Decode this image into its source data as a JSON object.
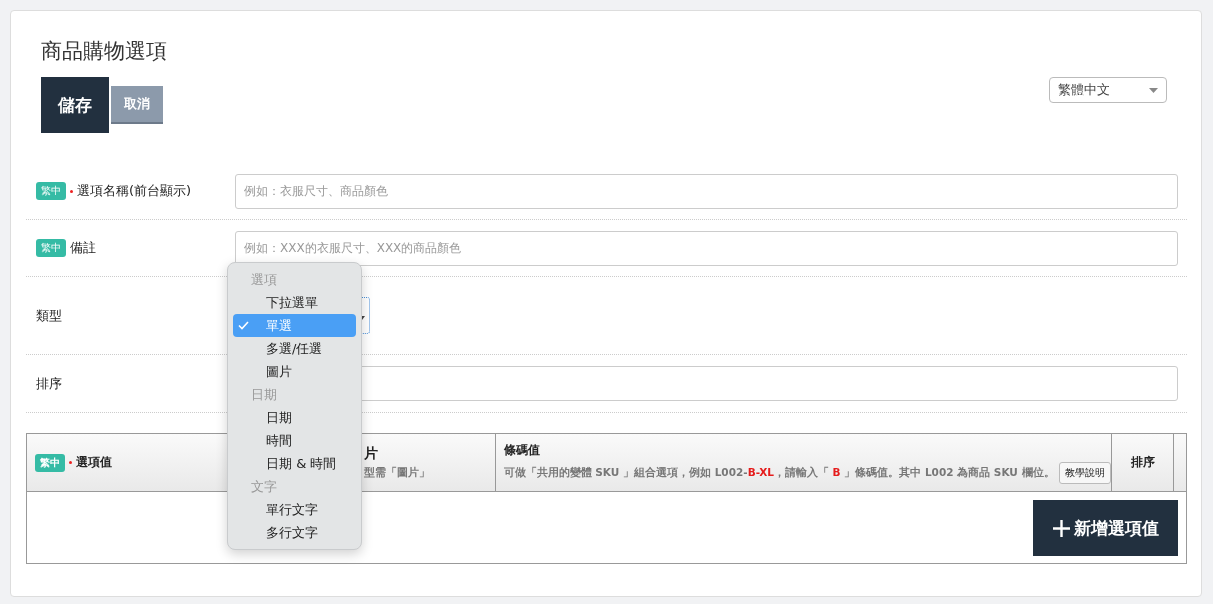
{
  "page_title": "商品購物選項",
  "buttons": [
    {
      "label": "儲存",
      "kind": "primary"
    },
    {
      "label": "取消",
      "kind": "secondary"
    }
  ],
  "language_select": {
    "value": "繁體中文"
  },
  "fields": [
    {
      "kind": "text",
      "lang_tag": "繁中",
      "required": true,
      "label": "選項名稱(前台顯示)",
      "placeholder": "例如：衣服尺寸、商品顏色"
    },
    {
      "kind": "text",
      "lang_tag": "繁中",
      "required": false,
      "label": "備註",
      "placeholder": "例如：XXX的衣服尺寸、XXX的商品顏色"
    },
    {
      "kind": "select",
      "label": "類型"
    },
    {
      "kind": "text",
      "label": "排序"
    }
  ],
  "type_menu": [
    {
      "group": "選項",
      "options": [
        {
          "label": "下拉選單",
          "selected": false
        },
        {
          "label": "單選",
          "selected": true
        },
        {
          "label": "多選/任選",
          "selected": false
        },
        {
          "label": "圖片",
          "selected": false
        }
      ]
    },
    {
      "group": "日期",
      "options": [
        {
          "label": "日期",
          "selected": false
        },
        {
          "label": "時間",
          "selected": false
        },
        {
          "label": "日期 & 時間",
          "selected": false
        }
      ]
    },
    {
      "group": "文字",
      "options": [
        {
          "label": "單行文字",
          "selected": false
        },
        {
          "label": "多行文字",
          "selected": false
        }
      ]
    }
  ],
  "table": {
    "columns": [
      {
        "kind": "value",
        "lang_tag": "繁中",
        "required": true,
        "title": "選項值"
      },
      {
        "kind": "image",
        "title": "片",
        "note": "型需「圖片」"
      },
      {
        "kind": "barcode",
        "title": "條碼值",
        "note": "可做「共用的變體 SKU 」組合選項，例如 L002-**B-XL**，請輸入「 **B** 」條碼值。其中 L002 為商品 SKU 欄位。",
        "help_button": "教學說明"
      },
      {
        "kind": "sort",
        "title": "排序"
      },
      {
        "kind": "spacer"
      }
    ],
    "add_button": "新增選項值"
  }
}
